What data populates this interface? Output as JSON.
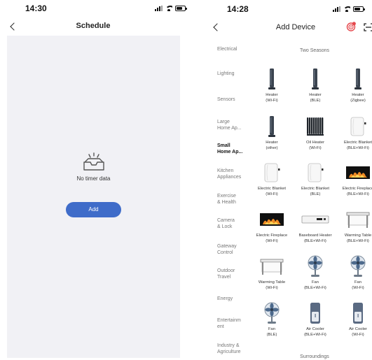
{
  "left": {
    "status_time": "14:30",
    "title": "Schedule",
    "empty_text": "No timer data",
    "add_label": "Add"
  },
  "right": {
    "status_time": "14:28",
    "title": "Add Device",
    "categories": [
      "Electrical",
      "Lighting",
      "Sensors",
      "Large\nHome Ap...",
      "Small\nHome Ap...",
      "Kitchen\nAppliances",
      "Exercise\n& Health",
      "Camera\n& Lock",
      "Gateway\nControl",
      "Outdoor\nTravel",
      "Energy",
      "Entertainm\nent",
      "Industry &\nAgriculture"
    ],
    "active_category": "Small\nHome Ap...",
    "sections": [
      "Two Seasons",
      "Surroundings"
    ],
    "devices": [
      {
        "name": "Heater\n(Wi-Fi)",
        "icon": "tower-heater-icon"
      },
      {
        "name": "Heater\n(BLE)",
        "icon": "tower-heater-icon"
      },
      {
        "name": "Heater\n(Zigbee)",
        "icon": "tower-heater-icon"
      },
      {
        "name": "Heater\n(other)",
        "icon": "tower-heater-icon"
      },
      {
        "name": "Oil Heater\n(Wi-Fi)",
        "icon": "oil-heater-icon"
      },
      {
        "name": "Electric Blanket\n(BLE+Wi-Fi)",
        "icon": "electric-blanket-icon"
      },
      {
        "name": "Electric Blanket\n(Wi-Fi)",
        "icon": "electric-blanket-icon"
      },
      {
        "name": "Electric Blanket\n(BLE)",
        "icon": "electric-blanket-icon"
      },
      {
        "name": "Electric Fireplace\n(BLE+Wi-Fi)",
        "icon": "fireplace-icon"
      },
      {
        "name": "Electric Fireplace\n(Wi-Fi)",
        "icon": "fireplace-icon"
      },
      {
        "name": "Baseboard Heater\n(BLE+Wi-Fi)",
        "icon": "baseboard-heater-icon"
      },
      {
        "name": "Warming Table\n(BLE+Wi-Fi)",
        "icon": "warming-table-icon"
      },
      {
        "name": "Warming Table\n(Wi-Fi)",
        "icon": "warming-table-icon"
      },
      {
        "name": "Fan\n(BLE+Wi-Fi)",
        "icon": "fan-icon"
      },
      {
        "name": "Fan\n(Wi-Fi)",
        "icon": "fan-icon"
      },
      {
        "name": "Fan\n(BLE)",
        "icon": "fan-icon"
      },
      {
        "name": "Air Cooler\n(BLE+Wi-Fi)",
        "icon": "air-cooler-icon"
      },
      {
        "name": "Air Cooler\n(Wi-Fi)",
        "icon": "air-cooler-icon"
      }
    ],
    "colors": {
      "accent_blue": "#3f6cc9",
      "badge_red": "#e5484d"
    }
  }
}
